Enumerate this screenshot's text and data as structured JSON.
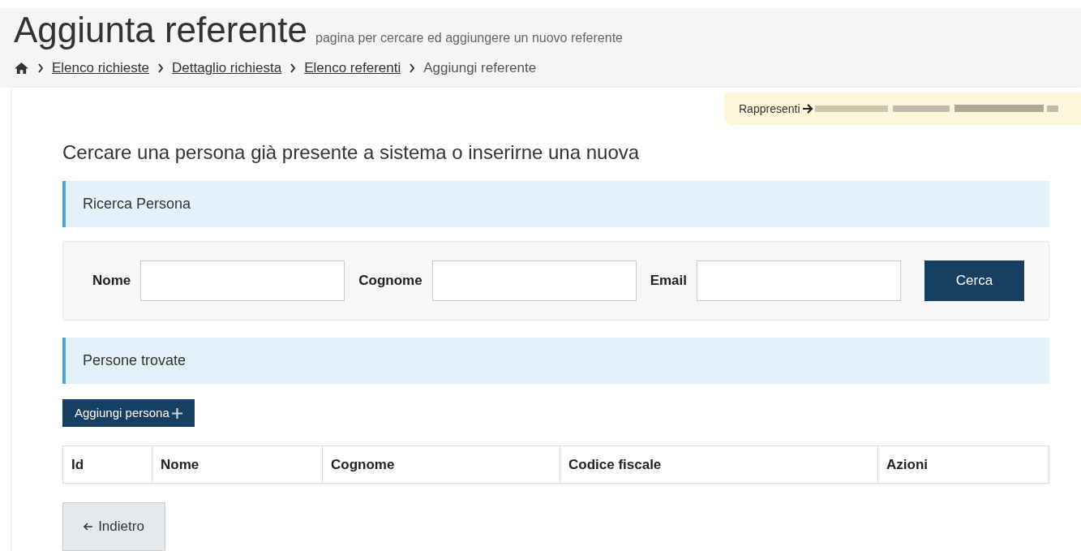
{
  "header": {
    "title": "Aggiunta referente",
    "subtitle": "pagina per cercare ed aggiungere un nuovo referente"
  },
  "breadcrumb": [
    {
      "label": "Elenco richieste",
      "link": true
    },
    {
      "label": "Dettaglio richiesta",
      "link": true
    },
    {
      "label": "Elenco referenti",
      "link": true
    },
    {
      "label": "Aggiungi referente",
      "link": false
    }
  ],
  "notice": {
    "label": "Rappresenti"
  },
  "heading": "Cercare una persona già presente a sistema o inserirne una nuova",
  "search_section": {
    "title": "Ricerca Persona",
    "fields": [
      {
        "label": "Nome"
      },
      {
        "label": "Cognome"
      },
      {
        "label": "Email"
      }
    ],
    "button": "Cerca"
  },
  "results_section": {
    "title": "Persone trovate",
    "add_button": "Aggiungi persona"
  },
  "table": {
    "columns": [
      "Id",
      "Nome",
      "Cognome",
      "Codice fiscale",
      "Azioni"
    ]
  },
  "back_button": "Indietro"
}
